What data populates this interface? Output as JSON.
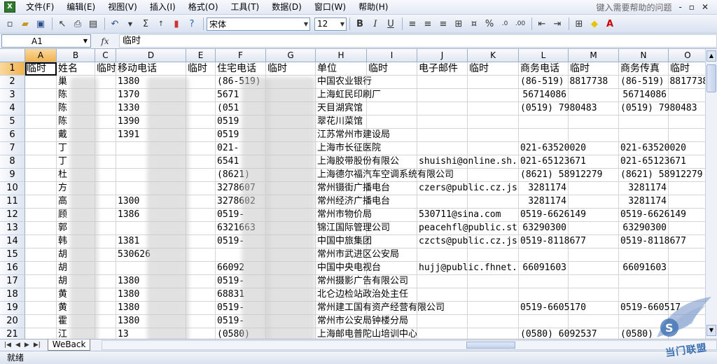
{
  "app_icon": "excel-icon",
  "menubar": {
    "items": [
      "文件(F)",
      "编辑(E)",
      "视图(V)",
      "插入(I)",
      "格式(O)",
      "工具(T)",
      "数据(D)",
      "窗口(W)",
      "帮助(H)"
    ],
    "help_placeholder": "键入需要帮助的问题",
    "window_buttons": [
      "-",
      "▫",
      "✕"
    ]
  },
  "toolbar": {
    "font_name": "宋体",
    "font_size": "12",
    "bold_label": "B",
    "italic_label": "I",
    "underline_label": "U",
    "sum_label": "Σ",
    "percent_label": "%"
  },
  "formula_bar": {
    "cell_ref": "A1",
    "fx_label": "fx",
    "content": "临时"
  },
  "columns": [
    "A",
    "B",
    "C",
    "D",
    "E",
    "F",
    "G",
    "H",
    "I",
    "J",
    "K",
    "L",
    "M",
    "N",
    "O"
  ],
  "rows": [
    {
      "num": "1",
      "cells": {
        "A": "临时",
        "B": "姓名",
        "C": "临时",
        "D": "移动电话",
        "E": "临时",
        "F": "住宅电话",
        "G": "临时",
        "H": "单位",
        "I": "临时",
        "J": "电子邮件",
        "K": "临时",
        "L": "商务电话",
        "M": "临时",
        "N": "商务传真",
        "O": "临时"
      }
    },
    {
      "num": "2",
      "cells": {
        "B": "巢",
        "D": "1380",
        "F": "(86-519)",
        "H": "中国农业银行",
        "L": "(86-519) 8817738",
        "N": "(86-519) 8817738"
      }
    },
    {
      "num": "3",
      "cells": {
        "B": "陈",
        "D": "1370",
        "F": "5671",
        "H": "上海虹民印刷厂",
        "L": "56714086",
        "N": "56714086"
      }
    },
    {
      "num": "4",
      "cells": {
        "B": "陈",
        "D": "1330",
        "F": "(051",
        "H": "天目湖宾馆",
        "L": "(0519) 7980483",
        "N": "(0519) 7980483"
      }
    },
    {
      "num": "5",
      "cells": {
        "B": "陈",
        "D": "1390",
        "F": "0519",
        "H": "翠花川菜馆"
      }
    },
    {
      "num": "6",
      "cells": {
        "B": "戴",
        "D": "1391",
        "F": "0519",
        "H": "江苏常州市建设局"
      }
    },
    {
      "num": "7",
      "cells": {
        "B": "丁",
        "F": "021-",
        "H": "上海市长征医院",
        "L": "021-63520020",
        "N": "021-63520020"
      }
    },
    {
      "num": "8",
      "cells": {
        "B": "丁",
        "F": "6541",
        "H": "上海胶带股份有限公",
        "J": "shuishi@online.sh.",
        "L": "021-65123671",
        "N": "021-65123671"
      }
    },
    {
      "num": "9",
      "cells": {
        "B": "杜",
        "F": "(8621)",
        "H": "上海德尔福汽车空调系统有限公司",
        "L": "(8621) 58912279",
        "N": "(8621) 58912279"
      }
    },
    {
      "num": "10",
      "cells": {
        "B": "方",
        "F": "3278607",
        "H": "常州镊街广播电台",
        "J": "czers@public.cz.js",
        "L": "3281174",
        "N": "3281174"
      }
    },
    {
      "num": "11",
      "cells": {
        "B": "高",
        "D": "1300",
        "F": "3278602",
        "H": "常州经济广播电台",
        "L": "3281174",
        "N": "3281174"
      }
    },
    {
      "num": "12",
      "cells": {
        "B": "顾",
        "D": "1386",
        "F": "0519-",
        "H": "常州市物价局",
        "J": "530711@sina.com",
        "L": "0519-6626149",
        "N": "0519-6626149"
      }
    },
    {
      "num": "13",
      "cells": {
        "B": "郭",
        "F": "6321663",
        "H": "锦江国际管理公司",
        "J": "peacehfl@public.st",
        "L": "63290300",
        "N": "63290300"
      }
    },
    {
      "num": "14",
      "cells": {
        "B": "韩",
        "D": "1381",
        "F": "0519-",
        "H": "中国中旅集团",
        "J": "czcts@public.cz.js",
        "L": "0519-8118677",
        "N": "0519-8118677"
      }
    },
    {
      "num": "15",
      "cells": {
        "B": "胡",
        "D": "530626",
        "H": "常州市武进区公安局"
      }
    },
    {
      "num": "16",
      "cells": {
        "B": "胡",
        "F": "66092",
        "H": "中国中央电视台",
        "J": "hujj@public.fhnet.",
        "L": "66091603",
        "N": "66091603"
      }
    },
    {
      "num": "17",
      "cells": {
        "B": "胡",
        "D": "1380",
        "F": "0519-",
        "H": "常州摄影广告有限公司"
      }
    },
    {
      "num": "18",
      "cells": {
        "B": "黄",
        "D": "1380",
        "F": "68831",
        "H": "北仑边检站政治处主任"
      }
    },
    {
      "num": "19",
      "cells": {
        "B": "黄",
        "D": "1380",
        "F": "0519-",
        "H": "常州建工国有资产经营有限公司",
        "L": "0519-6605170",
        "N": "0519-660517"
      }
    },
    {
      "num": "20",
      "cells": {
        "B": "霍",
        "D": "1380",
        "F": "0519-",
        "H": "常州市公安局钟楼分局"
      }
    },
    {
      "num": "21",
      "cells": {
        "B": "江",
        "D": "13",
        "F": "(0580)",
        "H": "上海邮电普陀山培训中心",
        "L": "(0580) 6092537",
        "N": "(0580)"
      }
    }
  ],
  "sheet_tab": "WeBack",
  "status_text": "就绪",
  "watermark_text": "当门联盟"
}
